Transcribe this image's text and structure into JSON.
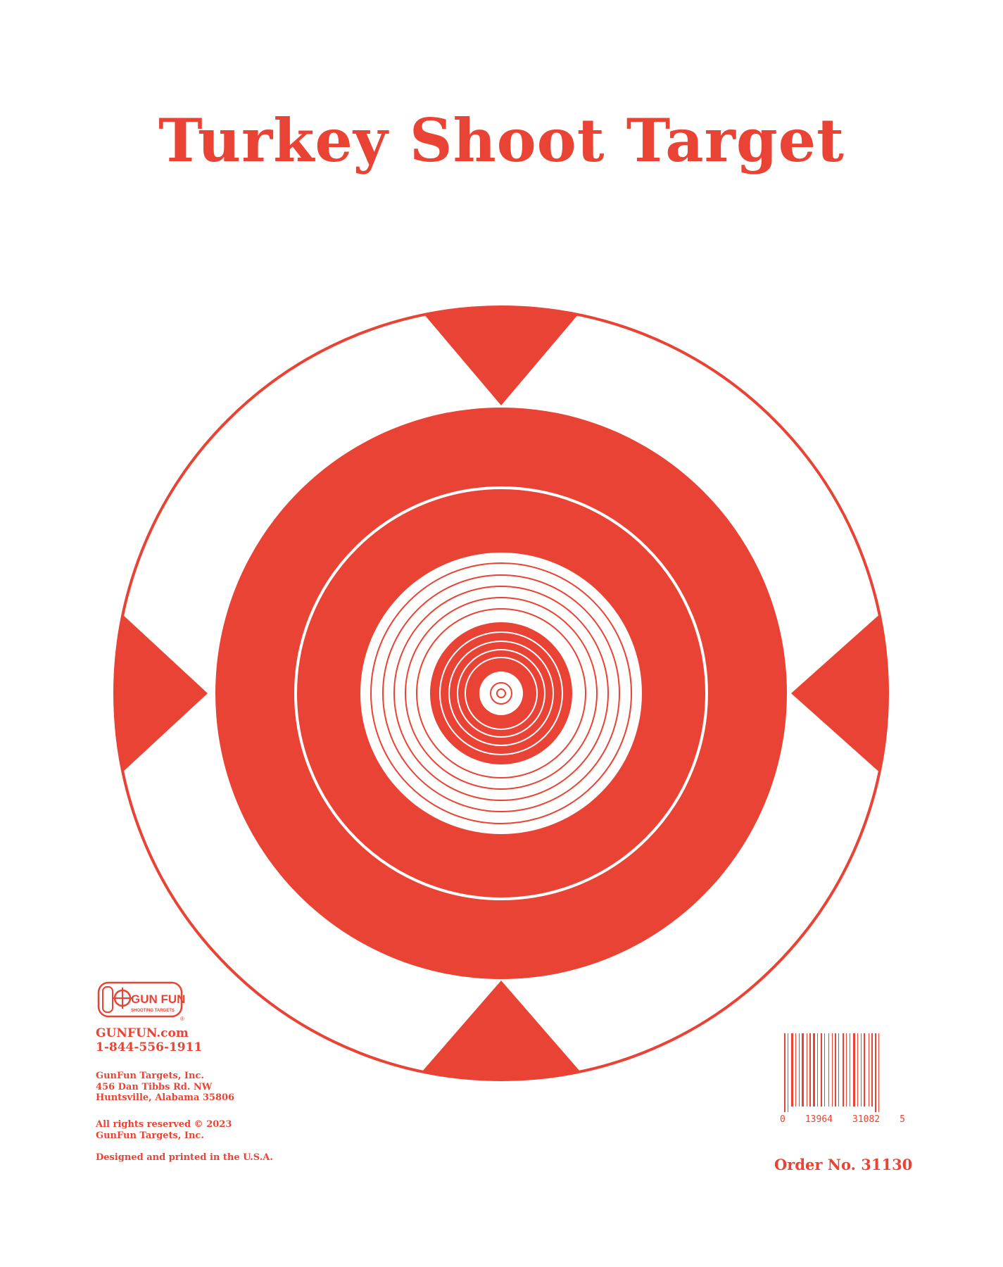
{
  "title": "Turkey Shoot Target",
  "colors": {
    "accent": "#e84335",
    "background": "#ffffff"
  },
  "logo": {
    "text": "GUN FUN",
    "subtext": "SHOOTING TARGETS",
    "registered": "®"
  },
  "contact": {
    "website": "GUNFUN.com",
    "phone": "1-844-556-1911"
  },
  "address": {
    "company": "GunFun Targets, Inc.",
    "street": "456 Dan Tibbs Rd. NW",
    "city": "Huntsville, Alabama 35806"
  },
  "rights": {
    "line1": "All rights reserved © 2023",
    "line2": "GunFun Targets, Inc."
  },
  "made_in": "Designed and printed in the U.S.A.",
  "barcode": {
    "left_digit": "0",
    "group1": "13964",
    "group2": "31082",
    "right_digit": "5"
  },
  "order_number": "Order No. 31130"
}
